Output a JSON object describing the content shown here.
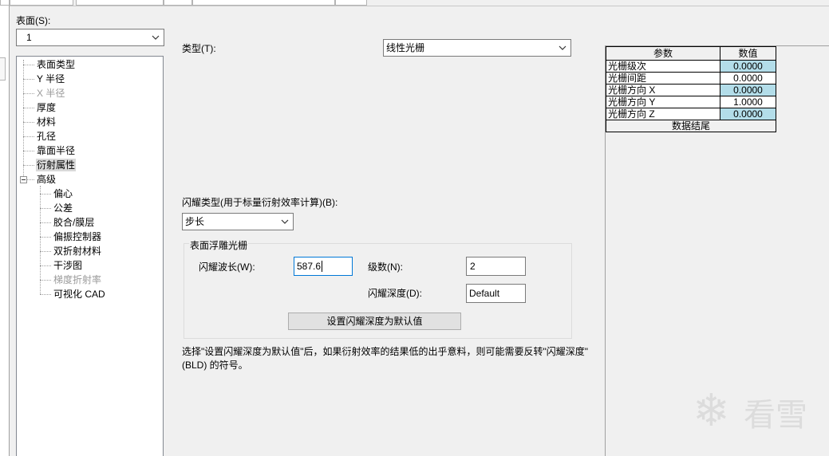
{
  "surface": {
    "label": "表面(S):",
    "value": "1"
  },
  "tree": {
    "items": [
      {
        "label": "表面类型"
      },
      {
        "label": "Y 半径"
      },
      {
        "label": "X 半径",
        "disabled": true
      },
      {
        "label": "厚度"
      },
      {
        "label": "材料"
      },
      {
        "label": "孔径"
      },
      {
        "label": "靠面半径"
      },
      {
        "label": "衍射属性",
        "selected": true
      },
      {
        "label": "高级",
        "expanded": true
      }
    ],
    "children": [
      {
        "label": "偏心"
      },
      {
        "label": "公差"
      },
      {
        "label": "胶合/膜层"
      },
      {
        "label": "偏振控制器"
      },
      {
        "label": "双折射材料"
      },
      {
        "label": "干涉图"
      },
      {
        "label": "梯度折射率",
        "disabled": true
      },
      {
        "label": "可视化 CAD"
      }
    ],
    "expander_icon": "collapse-minus-icon"
  },
  "type": {
    "label": "类型(T):",
    "value": "线性光栅"
  },
  "blaze_type": {
    "label": "闪耀类型(用于标量衍射效率计算)(B):",
    "value": "步长"
  },
  "relief_grating": {
    "title": "表面浮雕光栅",
    "blaze_wavelength": {
      "label": "闪耀波长(W):",
      "value": "587.6"
    },
    "order": {
      "label": "级数(N):",
      "value": "2"
    },
    "blaze_depth": {
      "label": "闪耀深度(D):",
      "value": "Default"
    },
    "reset_button": "设置闪耀深度为默认值"
  },
  "note": {
    "line1": "选择\"设置闪耀深度为默认值\"后，如果衍射效率的结果低的出乎意料，则可能需要反转\"闪耀深度\"",
    "line2": "(BLD) 的符号。"
  },
  "table": {
    "headers": [
      "参数",
      "数值"
    ],
    "rows": [
      {
        "param": "光栅级次",
        "value": "0.0000",
        "highlighted": true
      },
      {
        "param": "光栅间距",
        "value": "0.0000"
      },
      {
        "param": "光栅方向 X",
        "value": "0.0000",
        "highlighted": true
      },
      {
        "param": "光栅方向 Y",
        "value": "1.0000"
      },
      {
        "param": "光栅方向 Z",
        "value": "0.0000",
        "highlighted": true
      }
    ],
    "footer": "数据结尾"
  },
  "watermark": {
    "icon": "snowflake-icon",
    "text": "看雪"
  },
  "colors": {
    "panel_bg": "#f0f0f0",
    "focus_border": "#0078d7",
    "cell_highlight": "#b3dde9",
    "tree_selected": "#d9d9d9",
    "disabled_text": "#9a9a9a",
    "button_bg": "#e1e1e1"
  }
}
